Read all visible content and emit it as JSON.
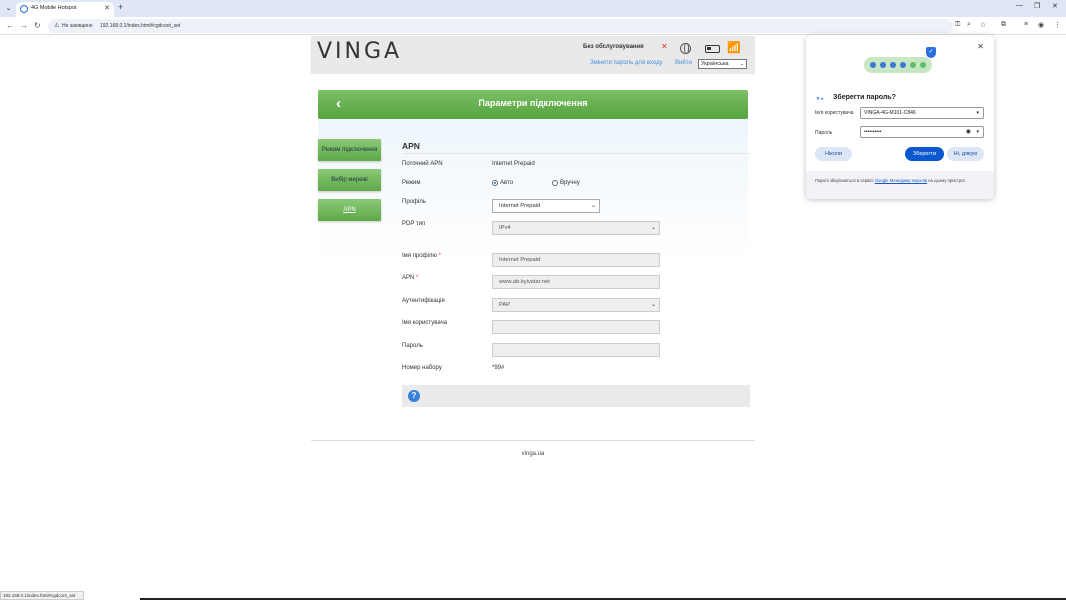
{
  "browser": {
    "tab_title": "4G Mobile Hotspot",
    "security_label": "Не захищено",
    "url": "192.168.0.1/index.html#cgdcont_set",
    "status_url": "192.168.0.1/index.html#cgdcont_set"
  },
  "header": {
    "logo": "VINGA",
    "service_status": "Без обслуговування",
    "change_password": "Змінити пароль для входу",
    "logout": "Вийти",
    "language": "Українська"
  },
  "title_bar": {
    "title": "Параметри підключення"
  },
  "sidebar": {
    "items": [
      {
        "label": "Режим підключення"
      },
      {
        "label": "Вибір мережі"
      },
      {
        "label": "APN"
      }
    ]
  },
  "form": {
    "section_title": "APN",
    "current_apn_label": "Поточний APN",
    "current_apn_value": "Internet Prepaid",
    "mode_label": "Режим",
    "mode_auto": "Авто",
    "mode_manual": "Вручну",
    "profile_label": "Профіль",
    "profile_value": "Internet Prepaid",
    "pdp_label": "PDP тип",
    "pdp_value": "IPv4",
    "profile_name_label": "Імя профілю",
    "profile_name_value": "Internet Prepaid",
    "apn_label": "APN",
    "apn_value": "www.ab.kyivstar.net",
    "auth_label": "Аутентифікація",
    "auth_value": "PAP",
    "username_label": "Імя користувача",
    "username_value": "",
    "password_label": "Пароль",
    "password_value": "",
    "dial_label": "Номер набору",
    "dial_value": "*99#",
    "required_mark": "*",
    "help_icon": "?"
  },
  "footer": {
    "text": "vinga.ua"
  },
  "password_popup": {
    "title": "Зберегти пароль?",
    "username_label": "Ім'я користувача",
    "username_value": "VINGA-4G-M101-C846",
    "password_label": "Пароль",
    "password_value": "••••••••••",
    "never_button": "Ніколи",
    "save_button": "Зберегти",
    "no_thanks_button": "Ні, дякую",
    "footer_text_before": "Паролі зберігаються в сервісі ",
    "footer_link": "Google Менеджер паролів",
    "footer_text_after": " на цьому пристрої."
  }
}
